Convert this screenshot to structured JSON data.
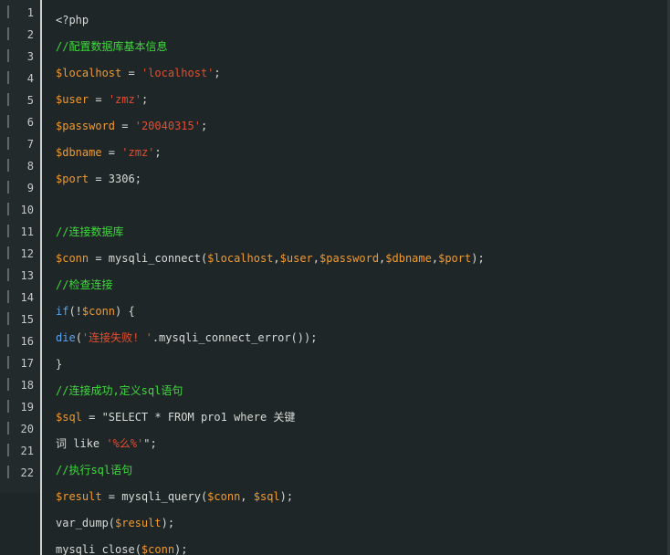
{
  "colors": {
    "background": "#1f2628",
    "comment": "#3fd93d",
    "variable": "#f09a2f",
    "string": "#e24e2f",
    "keyword": "#5aa4f0",
    "text": "#d7dad5"
  },
  "gutter": {
    "line_numbers": [
      "1",
      "2",
      "3",
      "4",
      "5",
      "6",
      "7",
      "8",
      "9",
      "10",
      "11",
      "12",
      "13",
      "14",
      "15",
      "16",
      "17",
      "18",
      "19",
      "20",
      "21",
      "22"
    ]
  },
  "code": {
    "lines": [
      [
        {
          "t": "<?php",
          "c": "plain"
        }
      ],
      [
        {
          "t": "//配置数据库基本信息",
          "c": "cmt"
        }
      ],
      [
        {
          "t": "$localhost",
          "c": "var"
        },
        {
          "t": " = ",
          "c": "plain"
        },
        {
          "t": "'localhost'",
          "c": "str"
        },
        {
          "t": ";",
          "c": "plain"
        }
      ],
      [
        {
          "t": "$user",
          "c": "var"
        },
        {
          "t": " = ",
          "c": "plain"
        },
        {
          "t": "'zmz'",
          "c": "str"
        },
        {
          "t": ";",
          "c": "plain"
        }
      ],
      [
        {
          "t": "$password",
          "c": "var"
        },
        {
          "t": " = ",
          "c": "plain"
        },
        {
          "t": "'20040315'",
          "c": "str"
        },
        {
          "t": ";",
          "c": "plain"
        }
      ],
      [
        {
          "t": "$dbname",
          "c": "var"
        },
        {
          "t": " = ",
          "c": "plain"
        },
        {
          "t": "'zmz'",
          "c": "str"
        },
        {
          "t": ";",
          "c": "plain"
        }
      ],
      [
        {
          "t": "$port",
          "c": "var"
        },
        {
          "t": " = 3306;",
          "c": "plain"
        }
      ],
      [],
      [
        {
          "t": "//连接数据库",
          "c": "cmt"
        }
      ],
      [
        {
          "t": "$conn",
          "c": "var"
        },
        {
          "t": " = mysqli_connect(",
          "c": "plain"
        },
        {
          "t": "$localhost",
          "c": "var"
        },
        {
          "t": ",",
          "c": "plain"
        },
        {
          "t": "$user",
          "c": "var"
        },
        {
          "t": ",",
          "c": "plain"
        },
        {
          "t": "$password",
          "c": "var"
        },
        {
          "t": ",",
          "c": "plain"
        },
        {
          "t": "$dbname",
          "c": "var"
        },
        {
          "t": ",",
          "c": "plain"
        },
        {
          "t": "$port",
          "c": "var"
        },
        {
          "t": ");",
          "c": "plain"
        }
      ],
      [
        {
          "t": "//检查连接",
          "c": "cmt"
        }
      ],
      [
        {
          "t": "if",
          "c": "kw"
        },
        {
          "t": "(!",
          "c": "plain"
        },
        {
          "t": "$conn",
          "c": "var"
        },
        {
          "t": ") {",
          "c": "plain"
        }
      ],
      [
        {
          "t": "die",
          "c": "kw"
        },
        {
          "t": "(",
          "c": "plain"
        },
        {
          "t": "'连接失败! '",
          "c": "str"
        },
        {
          "t": ".mysqli_connect_error());",
          "c": "plain"
        }
      ],
      [
        {
          "t": "}",
          "c": "plain"
        }
      ],
      [
        {
          "t": "//连接成功,定义sql语句",
          "c": "cmt"
        }
      ],
      [
        {
          "t": "$sql",
          "c": "var"
        },
        {
          "t": " = \"SELECT * FROM pro1 where 关键",
          "c": "plain"
        }
      ],
      [
        {
          "t": "词 like ",
          "c": "plain"
        },
        {
          "t": "'%么%'",
          "c": "str"
        },
        {
          "t": "\";",
          "c": "plain"
        }
      ],
      [
        {
          "t": "//执行sql语句",
          "c": "cmt"
        }
      ],
      [
        {
          "t": "$result",
          "c": "var"
        },
        {
          "t": " = mysqli_query(",
          "c": "plain"
        },
        {
          "t": "$conn",
          "c": "var"
        },
        {
          "t": ", ",
          "c": "plain"
        },
        {
          "t": "$sql",
          "c": "var"
        },
        {
          "t": ");",
          "c": "plain"
        }
      ],
      [
        {
          "t": "var_dump(",
          "c": "plain"
        },
        {
          "t": "$result",
          "c": "var"
        },
        {
          "t": ");",
          "c": "plain"
        }
      ],
      [
        {
          "t": "mysqli_close(",
          "c": "plain"
        },
        {
          "t": "$conn",
          "c": "var"
        },
        {
          "t": ");",
          "c": "plain"
        }
      ]
    ]
  }
}
